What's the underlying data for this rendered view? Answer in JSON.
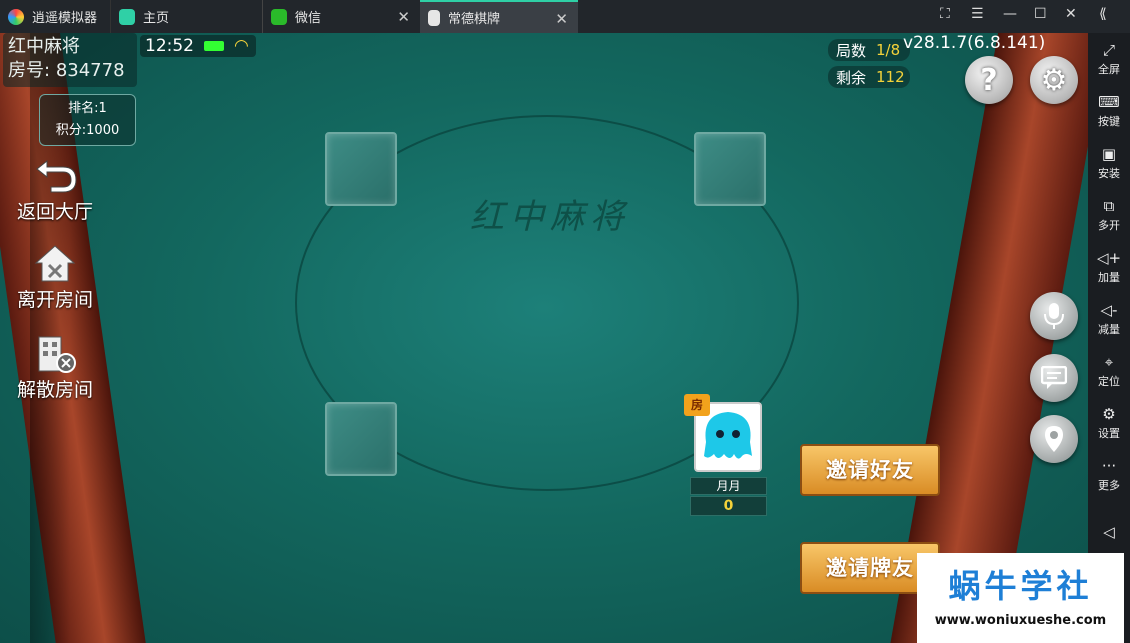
{
  "titlebar": {
    "tabs": [
      {
        "label": "逍遥模拟器"
      },
      {
        "label": "主页"
      },
      {
        "label": "微信"
      },
      {
        "label": "常德棋牌"
      }
    ],
    "close_glyph": "✕",
    "window_controls": [
      "⛶",
      "☰",
      "—",
      "☐",
      "✕",
      "⟪"
    ]
  },
  "room": {
    "name": "红中麻将",
    "number_label": "房号:",
    "number": "834778"
  },
  "status": {
    "time": "12:52",
    "wifi_glyph": "◠"
  },
  "rank": {
    "rank_label": "排名:1",
    "score_label": "积分:1000"
  },
  "left_actions": [
    {
      "label": "返回大厅",
      "icon": "back-arrow-icon"
    },
    {
      "label": "离开房间",
      "icon": "leave-house-icon"
    },
    {
      "label": "解散房间",
      "icon": "dissolve-building-icon"
    }
  ],
  "game_info": {
    "rounds_label": "局数",
    "rounds_value": "1/8",
    "remain_label": "剩余",
    "remain_value": "112",
    "version": "v28.1.7(6.8.141)"
  },
  "table": {
    "title": "红中麻将"
  },
  "player": {
    "host_badge": "房",
    "name": "月月",
    "score": "0"
  },
  "invite": {
    "friends": "邀请好友",
    "card_friends": "邀请牌友"
  },
  "right_buttons": {
    "help": "?",
    "settings": "⚙"
  },
  "sidebar": [
    {
      "glyph": "⤢",
      "label": "全屏"
    },
    {
      "glyph": "⌨",
      "label": "按键"
    },
    {
      "glyph": "▣",
      "label": "安装"
    },
    {
      "glyph": "⧉",
      "label": "多开"
    },
    {
      "glyph": "◁+",
      "label": "加量"
    },
    {
      "glyph": "◁-",
      "label": "减量"
    },
    {
      "glyph": "⌖",
      "label": "定位"
    },
    {
      "glyph": "⚙",
      "label": "设置"
    },
    {
      "glyph": "···",
      "label": "更多"
    },
    {
      "glyph": "◁",
      "label": ""
    }
  ],
  "watermark": {
    "title": "蜗牛学社",
    "url": "www.woniuxueshe.com"
  },
  "colors": {
    "felt": "#13685f",
    "wood": "#a8462a",
    "accent": "#2fd0a6",
    "gold": "#f4d23a"
  }
}
